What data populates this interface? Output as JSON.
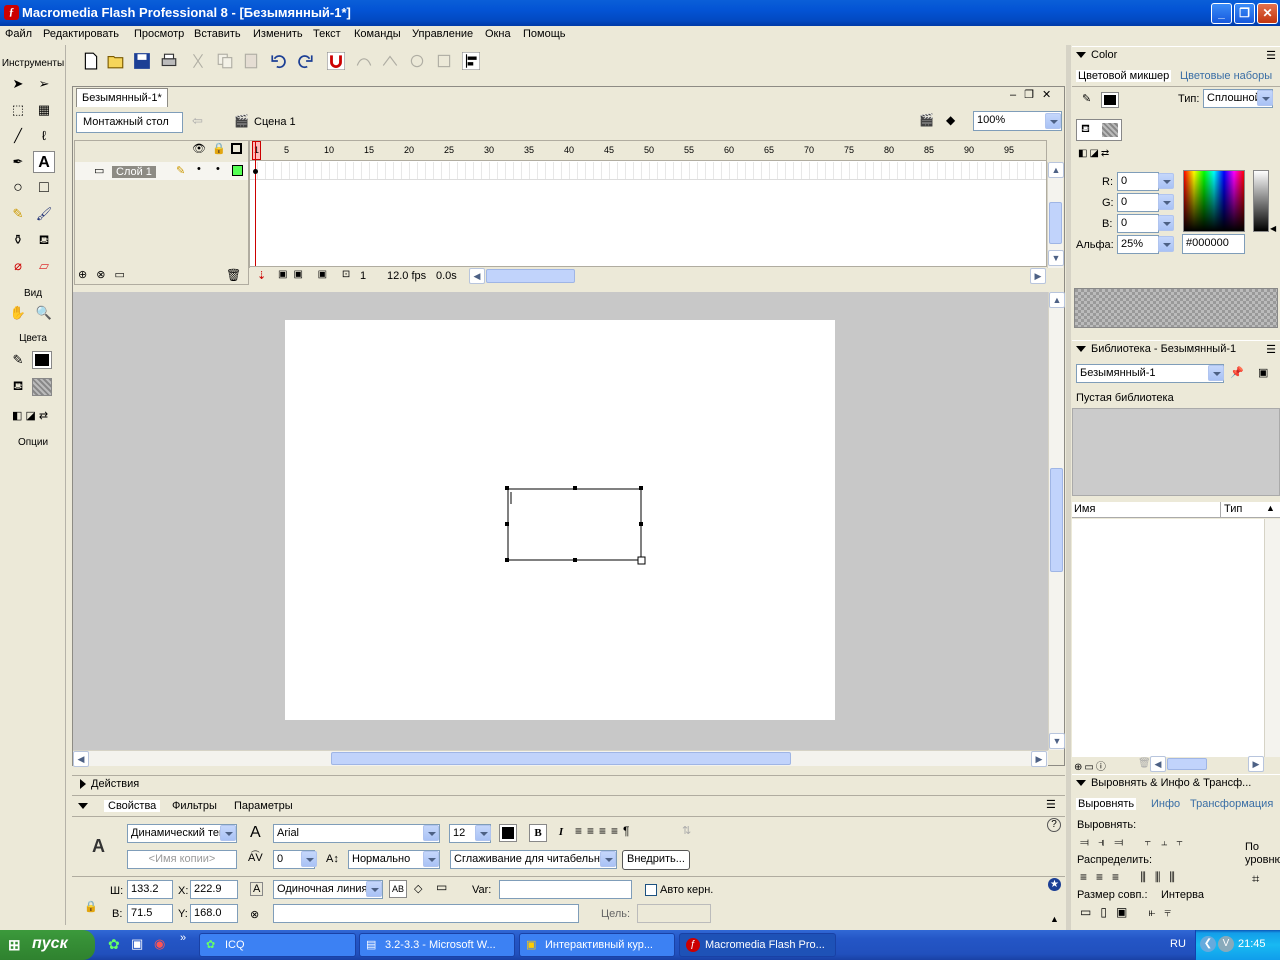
{
  "window": {
    "title": "Macromedia Flash Professional 8 - [Безымянный-1*]"
  },
  "menu": [
    "Файл",
    "Редактировать",
    "Просмотр",
    "Вставить",
    "Изменить",
    "Текст",
    "Команды",
    "Управление",
    "Окна",
    "Помощь"
  ],
  "tools": {
    "title": "Инструменты",
    "view_label": "Вид",
    "colors_label": "Цвета",
    "options_label": "Опции"
  },
  "document": {
    "tab": "Безымянный-1*",
    "timeline_button": "Монтажный стол",
    "scene": "Сцена 1",
    "zoom": "100%"
  },
  "timeline": {
    "layer": "Слой 1",
    "frame_numbers": [
      "1",
      "5",
      "10",
      "15",
      "20",
      "25",
      "30",
      "35",
      "40",
      "45",
      "50",
      "55",
      "60",
      "65",
      "70",
      "75",
      "80",
      "85",
      "90",
      "95"
    ],
    "current_frame": "1",
    "fps": "12.0 fps",
    "time": "0.0s"
  },
  "color_panel": {
    "title": "Color",
    "tab_mixer": "Цветовой микшер",
    "tab_swatches": "Цветовые наборы",
    "type_label": "Тип:",
    "type_value": "Сплошной",
    "r_label": "R:",
    "r": "0",
    "g_label": "G:",
    "g": "0",
    "b_label": "B:",
    "b": "0",
    "alpha_label": "Альфа:",
    "alpha": "25%",
    "hex": "#000000"
  },
  "library": {
    "title": "Библиотека - Безымянный-1",
    "doc_select": "Безымянный-1",
    "empty": "Пустая библиотека",
    "col_name": "Имя",
    "col_type": "Тип"
  },
  "align_panel": {
    "title": "Выровнять & Инфо & Трансф...",
    "tab_align": "Выровнять",
    "tab_info": "Инфо",
    "tab_transform": "Трансформация",
    "align_label": "Выровнять:",
    "distribute_label": "Распределить:",
    "match_label": "Размер совп.:",
    "space_label": "Интерва",
    "stage_label": "По",
    "stage_label2": "уровню"
  },
  "actions": {
    "title": "Действия"
  },
  "properties": {
    "tab_props": "Свойства",
    "tab_filters": "Фильтры",
    "tab_params": "Параметры",
    "text_type": "Динамический текст",
    "instance_placeholder": "<Имя копии>",
    "font": "Arial",
    "size": "12",
    "spacing": "0",
    "position": "Нормально",
    "antialias": "Сглаживание для читабельности",
    "embed": "Внедрить...",
    "w_label": "Ш:",
    "w": "133.2",
    "x_label": "X:",
    "x": "222.9",
    "h_label": "В:",
    "h": "71.5",
    "y_label": "Y:",
    "y": "168.0",
    "line_type": "Одиночная линия",
    "var_label": "Var:",
    "auto_kern": "Авто керн.",
    "target_label": "Цель:"
  },
  "taskbar": {
    "start": "пуск",
    "tasks": [
      "ICQ",
      "3.2-3.3 - Microsoft W...",
      "Интерактивный кур...",
      "Macromedia Flash Pro..."
    ],
    "lang": "RU",
    "clock": "21:45"
  },
  "accent": "#0353d4"
}
